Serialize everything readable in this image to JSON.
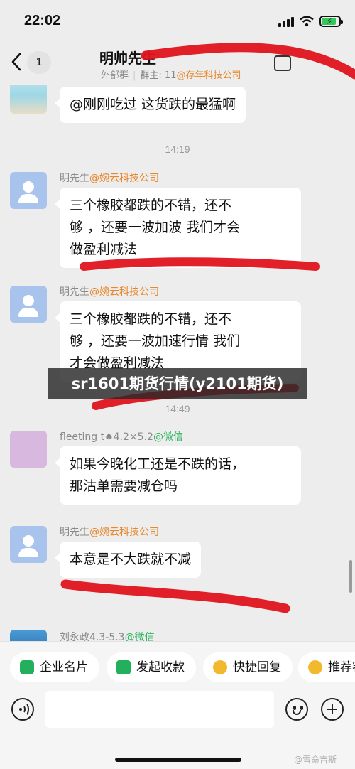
{
  "status": {
    "time": "22:02"
  },
  "header": {
    "back_count": "1",
    "title": "明帅先生",
    "subtitle_tag": "外部群",
    "subtitle_owner_label": "群主: 11",
    "subtitle_owner_org": "@存年科技公司"
  },
  "messages": [
    {
      "sender": "",
      "org": "",
      "text": "@刚刚吃过 这货跌的最猛啊"
    },
    {
      "timestamp": "14:19"
    },
    {
      "sender": "明先生",
      "org": "@婉云科技公司",
      "lines": [
        "三个橡胶都跌的不错，还不",
        "够 ，还要一波加波  我们才会",
        "做盈利减法"
      ]
    },
    {
      "sender": "明先生",
      "org": "@婉云科技公司",
      "lines": [
        "三个橡胶都跌的不错，还不",
        "够 ，还要一波加速行情    我们",
        "才会做盈利减法"
      ]
    },
    {
      "timestamp": "14:49"
    },
    {
      "sender": "fleeting t♠4.2×5.2",
      "org": "@微信",
      "lines": [
        "如果今晚化工还是不跌的话，",
        "那沽单需要减仓吗"
      ]
    },
    {
      "sender": "明先生",
      "org": "@婉云科技公司",
      "lines": [
        "本意是不大跌就不减"
      ]
    },
    {
      "sender": "刘永政4.3-5.3",
      "org": "@微信"
    }
  ],
  "overlay_banner": "sr1601期货行情(y2101期货)",
  "quickbar": {
    "chips": [
      "企业名片",
      "发起收款",
      "快捷回复",
      "推荐客"
    ]
  },
  "input": {
    "placeholder": ""
  },
  "watermark": "@雪命吉斯",
  "colors": {
    "org_orange": "#e8862a",
    "wechat_green": "#27b45a",
    "marker_red": "#e0141e"
  }
}
